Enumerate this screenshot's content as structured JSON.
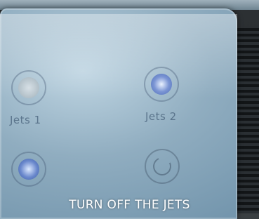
{
  "controls": {
    "jets1": {
      "label": "Jets 1",
      "icon": "jet-pump-icon"
    },
    "jets2": {
      "label": "Jets 2",
      "icon": "jet-pump-icon"
    },
    "jets3": {
      "label": "",
      "icon": "jet-pump-icon"
    },
    "power": {
      "label": "",
      "icon": "power-icon"
    }
  },
  "caption": {
    "text": "TURN OFF THE JETS"
  },
  "colors": {
    "panel": "#90adc0",
    "accent": "#4f6eb8",
    "caption": "#ffffff"
  }
}
